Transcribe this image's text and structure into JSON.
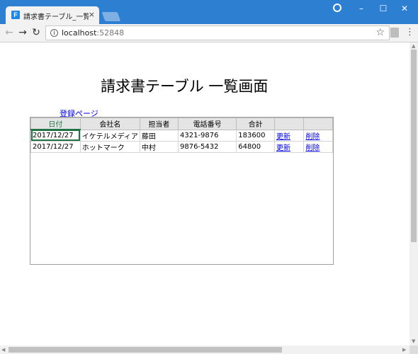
{
  "browser": {
    "tab_title": "請求書テーブル_一覧ページ",
    "tab_close": "×",
    "favicon_letter": "F",
    "address_host": "localhost",
    "address_port": ":52848",
    "window_controls": {
      "minimize": "–",
      "maximize": "☐",
      "close": "✕"
    },
    "colors": {
      "titlebar": "#2c7fd1",
      "toolbar": "#f2f2f2"
    }
  },
  "page": {
    "title": "請求書テーブル 一覧画面",
    "register_link": "登録ページ"
  },
  "grid": {
    "columns": [
      "日付",
      "会社名",
      "担当者",
      "電話番号",
      "合計",
      "",
      ""
    ],
    "rows": [
      {
        "date": "2017/12/27",
        "company": "イケテルメディア",
        "person": "藤田",
        "phone": "4321-9876",
        "total": "183600",
        "update": "更新",
        "delete": "削除"
      },
      {
        "date": "2017/12/27",
        "company": "ホットマーク",
        "person": "中村",
        "phone": "9876-5432",
        "total": "64800",
        "update": "更新",
        "delete": "削除"
      }
    ],
    "selected_color": "#217346",
    "link_color": "#0000ee"
  },
  "icons": {
    "back": "arrow-left-icon",
    "forward": "arrow-right-icon",
    "reload": "reload-icon",
    "info": "info-icon",
    "star": "star-icon",
    "extension": "extension-icon",
    "menu": "menu-icon",
    "profile": "profile-icon"
  }
}
